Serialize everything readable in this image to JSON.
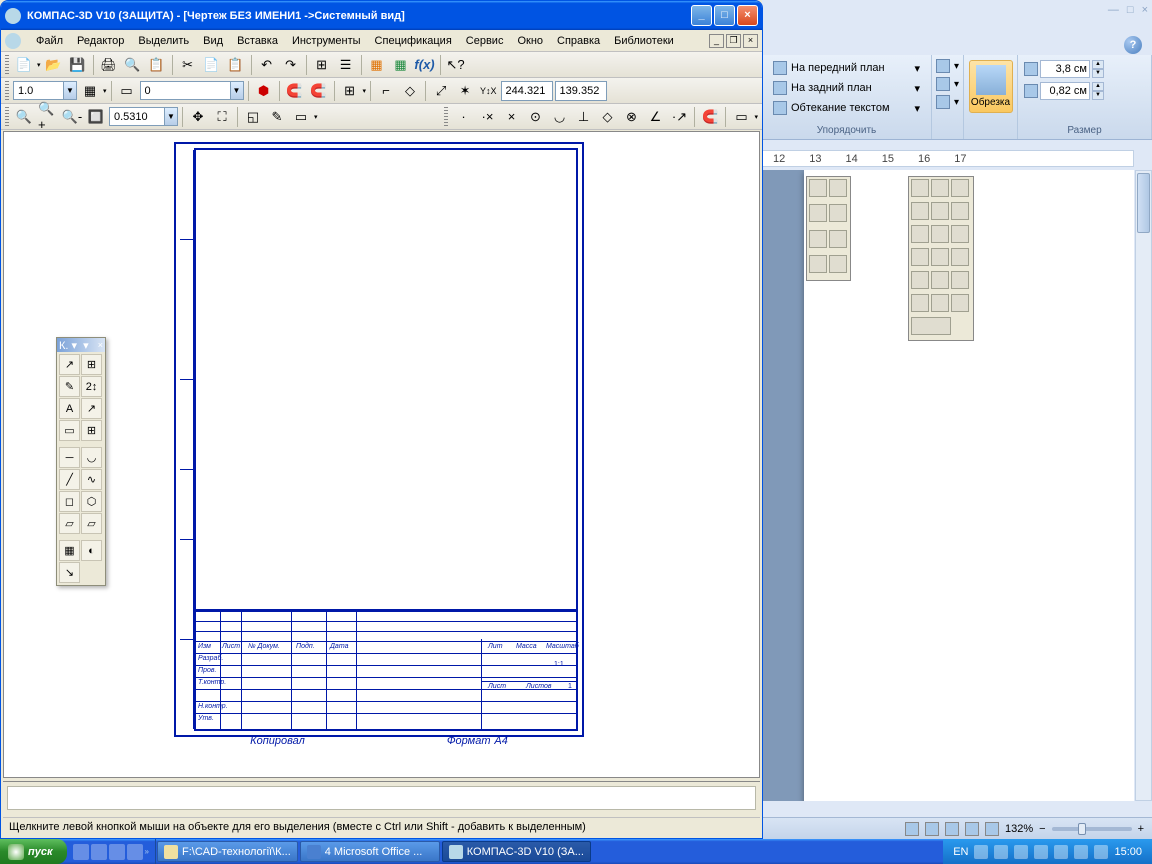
{
  "kompas": {
    "title": "КОМПАС-3D V10 (ЗАЩИТА) - [Чертеж БЕЗ ИМЕНИ1 ->Системный вид]",
    "menu": [
      "Файл",
      "Редактор",
      "Выделить",
      "Вид",
      "Вставка",
      "Инструменты",
      "Спецификация",
      "Сервис",
      "Окно",
      "Справка",
      "Библиотеки"
    ],
    "tb2": {
      "combo1": "1.0",
      "combo2": "0",
      "coord_x": "244.321",
      "coord_y": "139.352"
    },
    "tb3": {
      "zoom": "0.5310"
    },
    "palette_title": "К. ▾",
    "status": "Щелкните левой кнопкой мыши на объекте для его выделения (вместе с Ctrl или Shift - добавить к выделенным)",
    "drawing": {
      "lit": "Лит",
      "mass": "Масса",
      "scale_lbl": "Масштаб",
      "scale": "1:1",
      "list": "Лист",
      "lists": "Листов",
      "lists_n": "1",
      "format": "Формат",
      "fmt": "A4",
      "copy": "Копировал",
      "izm": "Изм",
      "listn": "Лист",
      "doc": "№ Докум.",
      "podp": "Подп.",
      "data": "Дата",
      "razr": "Разраб.",
      "prov": "Пров.",
      "tkontr": "Т.контр.",
      "nkontr": "Н.контр.",
      "utv": "Утв."
    }
  },
  "word": {
    "arrange": {
      "front": "На передний план",
      "back": "На задний план",
      "wrap": "Обтекание текстом",
      "label": "Упорядочить"
    },
    "crop": {
      "btn": "Обрезка"
    },
    "size": {
      "h": "3,8 см",
      "w": "0,82 см",
      "label": "Размер"
    },
    "ruler": [
      "12",
      "13",
      "14",
      "15",
      "16",
      "17"
    ],
    "status": {
      "zoom": "132%"
    }
  },
  "taskbar": {
    "start": "пуск",
    "tasks": [
      {
        "label": "F:\\CAD-технології\\К...",
        "active": false
      },
      {
        "label": "4 Microsoft Office ...",
        "active": false
      },
      {
        "label": "КОМПАС-3D V10 (ЗА...",
        "active": true
      }
    ],
    "lang": "EN",
    "time": "15:00"
  }
}
